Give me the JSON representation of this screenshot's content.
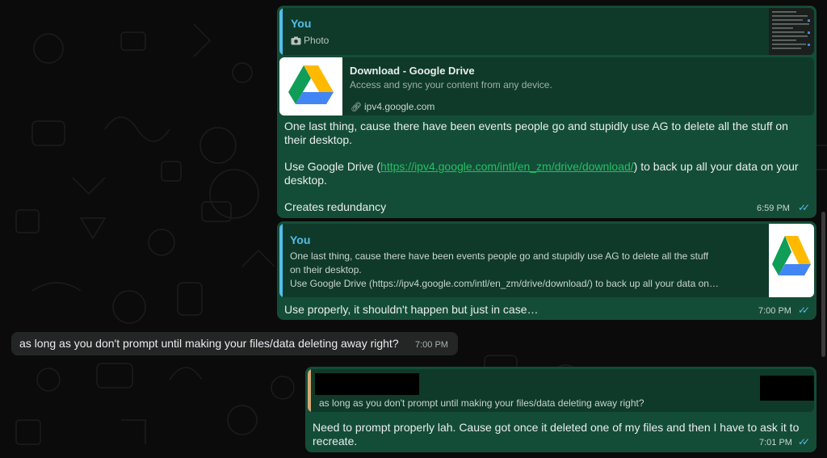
{
  "messages": {
    "m1": {
      "quote_sender": "You",
      "quote_type": "Photo",
      "preview_title": "Download - Google Drive",
      "preview_desc": "Access and sync your content from any device.",
      "preview_domain": "ipv4.google.com",
      "line1": "One last thing, cause there have been events people go and stupidly use AG to delete all the stuff on",
      "line2": "their desktop.",
      "line3_pre": "Use Google Drive (",
      "line3_link": "https://ipv4.google.com/intl/en_zm/drive/download/",
      "line3_post": ") to back up all your data on your",
      "line4": "desktop.",
      "line5": "Creates redundancy",
      "time": "6:59 PM"
    },
    "m2": {
      "quote_sender": "You",
      "quote_line1": "One last thing, cause there have been events people go and stupidly use AG to delete all the stuff",
      "quote_line2": "on their desktop.",
      "quote_line3": "Use Google Drive (https://ipv4.google.com/intl/en_zm/drive/download/) to back up all your data on…",
      "text": "Use properly, it shouldn't happen but just in case…",
      "time": "7:00 PM"
    },
    "m3": {
      "text": "as long as you don't prompt until making your files/data deleting away right?",
      "time": "7:00 PM"
    },
    "m4": {
      "quote_text": "as long as you don't prompt until making your files/data deleting away right?",
      "line1": "Need to prompt properly lah. Cause got once it deleted one of my files and then I have to ask it to",
      "line2": "recreate.",
      "time": "7:01 PM"
    }
  },
  "icons": {
    "camera": "camera-icon",
    "link": "link-icon",
    "read_receipt": "double-check-icon",
    "drive": "google-drive-logo"
  },
  "colors": {
    "outgoing_bubble": "#144d37",
    "incoming_bubble": "#242626",
    "quote_you_bar": "#53bdeb",
    "quote_other_bar": "#d6a977",
    "link": "#21c063",
    "ticks": "#53bdeb"
  }
}
